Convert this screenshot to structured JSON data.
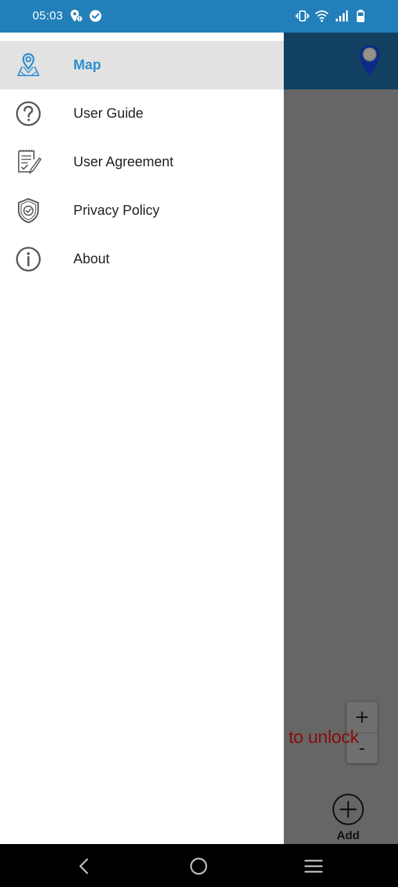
{
  "status_bar": {
    "time": "05:03",
    "left_icons": [
      "location-alert-icon",
      "check-circle-icon"
    ],
    "right_icons": [
      "vibrate-icon",
      "wifi-icon",
      "signal-icon",
      "battery-icon"
    ]
  },
  "drawer": {
    "items": [
      {
        "label": "Map",
        "icon": "map-pin-icon",
        "selected": true
      },
      {
        "label": "User Guide",
        "icon": "help-circle-icon",
        "selected": false
      },
      {
        "label": "User Agreement",
        "icon": "document-check-icon",
        "selected": false
      },
      {
        "label": "Privacy Policy",
        "icon": "shield-check-icon",
        "selected": false
      },
      {
        "label": "About",
        "icon": "info-icon",
        "selected": false
      }
    ]
  },
  "app": {
    "zoom_in_label": "+",
    "zoom_out_label": "-",
    "unlock_text": "to unlock",
    "add_label": "Add"
  },
  "colors": {
    "status_bar": "#227fb9",
    "accent": "#2a8fce",
    "selected_bg": "#e2e2e2",
    "scrim_toolbar": "#114061",
    "scrim_content": "#666666",
    "unlock_text": "#8a0b0b"
  },
  "nav_bar": {
    "buttons": [
      "back-icon",
      "home-icon",
      "menu-icon"
    ]
  }
}
